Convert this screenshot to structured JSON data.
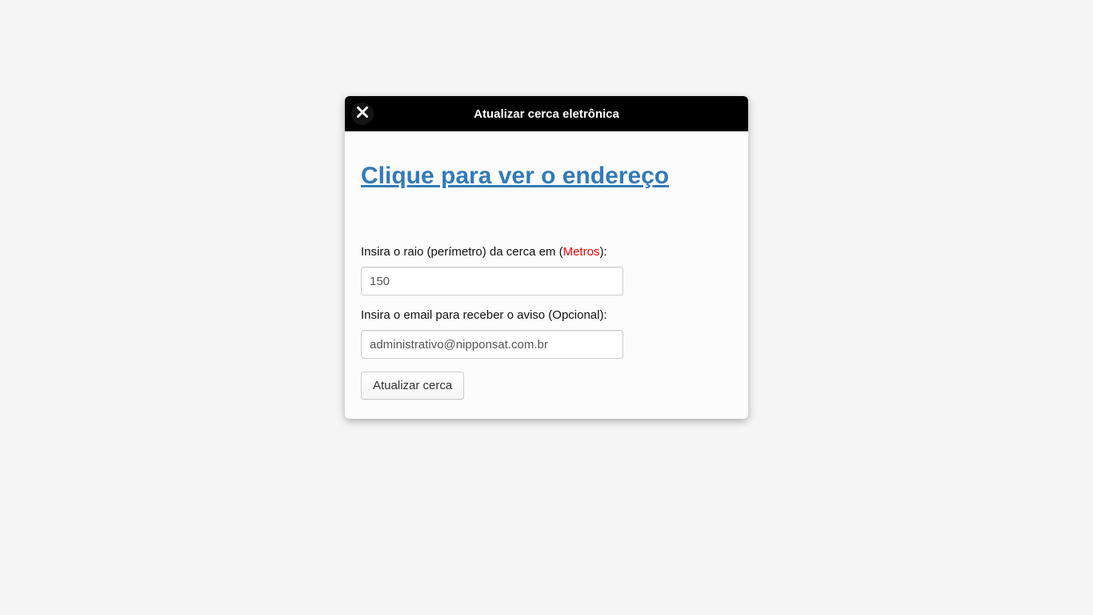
{
  "popup": {
    "title": "Atualizar cerca eletrônica",
    "address_link": "Clique para ver o endereço",
    "radius_label_prefix": "Insira o raio (perímetro) da cerca em (",
    "radius_unit": "Metros",
    "radius_label_suffix": "):",
    "radius_value": "150",
    "email_label": "Insira o email para receber o aviso (Opcional):",
    "email_value": "administrativo@nipponsat.com.br",
    "submit_label": "Atualizar cerca"
  }
}
